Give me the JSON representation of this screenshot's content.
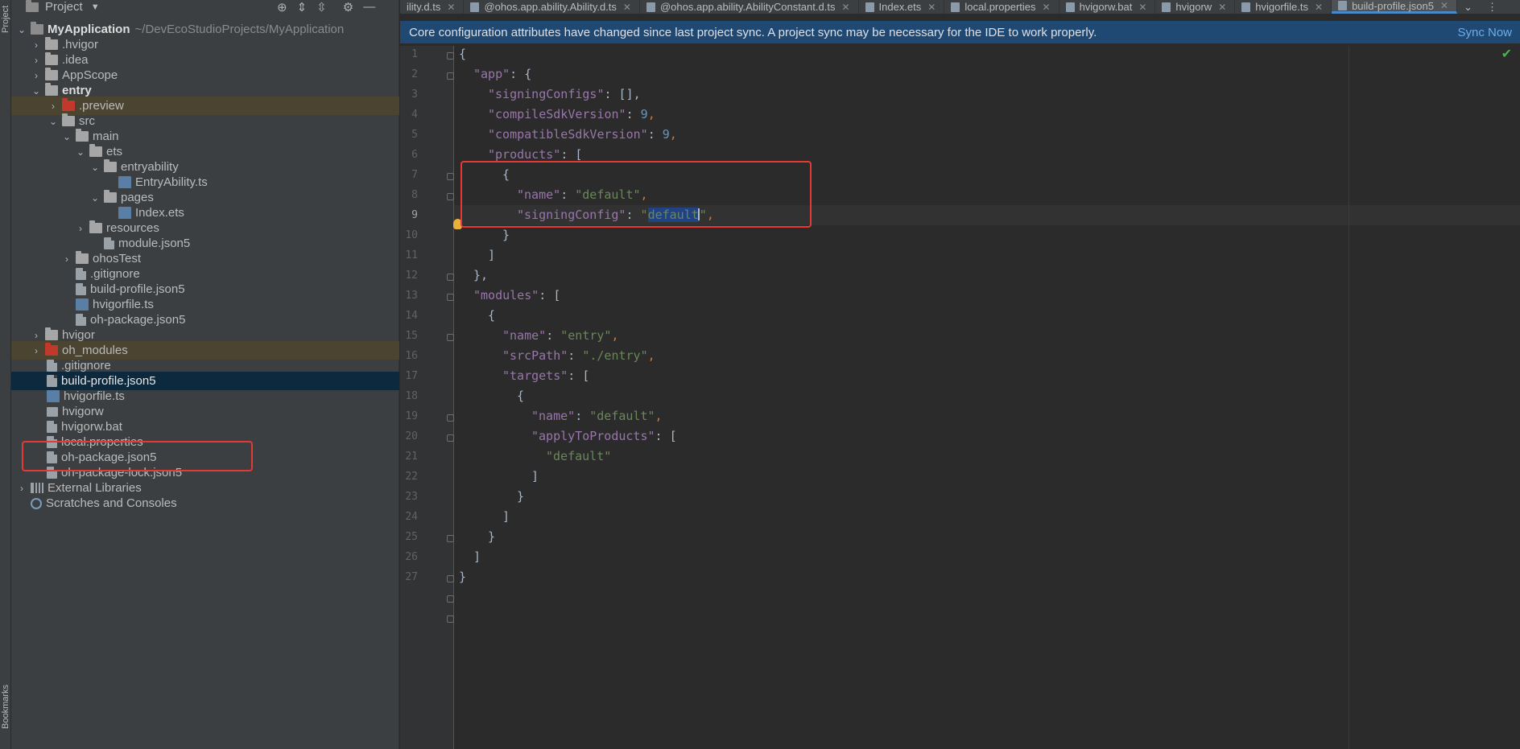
{
  "toolstrip": {
    "project_label": "Project",
    "bookmarks_label": "Bookmarks"
  },
  "project_panel": {
    "title": "Project",
    "tree": [
      {
        "label": "MyApplication",
        "path": "~/DevEcoStudioProjects/MyApplication"
      },
      {
        "label": ".hvigor"
      },
      {
        "label": ".idea"
      },
      {
        "label": "AppScope"
      },
      {
        "label": "entry"
      },
      {
        "label": ".preview"
      },
      {
        "label": "src"
      },
      {
        "label": "main"
      },
      {
        "label": "ets"
      },
      {
        "label": "entryability"
      },
      {
        "label": "EntryAbility.ts"
      },
      {
        "label": "pages"
      },
      {
        "label": "Index.ets"
      },
      {
        "label": "resources"
      },
      {
        "label": "module.json5"
      },
      {
        "label": "ohosTest"
      },
      {
        "label": ".gitignore"
      },
      {
        "label": "build-profile.json5"
      },
      {
        "label": "hvigorfile.ts"
      },
      {
        "label": "oh-package.json5"
      },
      {
        "label": "hvigor"
      },
      {
        "label": "oh_modules"
      },
      {
        "label": ".gitignore"
      },
      {
        "label": "build-profile.json5"
      },
      {
        "label": "hvigorfile.ts"
      },
      {
        "label": "hvigorw"
      },
      {
        "label": "hvigorw.bat"
      },
      {
        "label": "local.properties"
      },
      {
        "label": "oh-package.json5"
      },
      {
        "label": "oh-package-lock.json5"
      },
      {
        "label": "External Libraries"
      },
      {
        "label": "Scratches and Consoles"
      }
    ]
  },
  "tabs": [
    {
      "label": "ility.d.ts"
    },
    {
      "label": "@ohos.app.ability.Ability.d.ts"
    },
    {
      "label": "@ohos.app.ability.AbilityConstant.d.ts"
    },
    {
      "label": "Index.ets"
    },
    {
      "label": "local.properties"
    },
    {
      "label": "hvigorw.bat"
    },
    {
      "label": "hvigorw"
    },
    {
      "label": "hvigorfile.ts"
    },
    {
      "label": "build-profile.json5"
    }
  ],
  "banner": {
    "message": "Core configuration attributes have changed since last project sync. A project sync may be necessary for the IDE to work properly.",
    "action": "Sync Now"
  },
  "editor": {
    "current_line": 9,
    "line_numbers": [
      "1",
      "2",
      "3",
      "4",
      "5",
      "6",
      "7",
      "8",
      "9",
      "10",
      "11",
      "12",
      "13",
      "14",
      "15",
      "16",
      "17",
      "18",
      "19",
      "20",
      "21",
      "22",
      "23",
      "24",
      "25",
      "26",
      "27"
    ],
    "code": {
      "l1": "{",
      "l2_key": "\"app\"",
      "l2_rest": ": {",
      "l3_key": "\"signingConfigs\"",
      "l3_rest": ": [],",
      "l4_key": "\"compileSdkVersion\"",
      "l4_num": "9",
      "l5_key": "\"compatibleSdkVersion\"",
      "l5_num": "9",
      "l6_key": "\"products\"",
      "l6_rest": ": [",
      "l7": "{",
      "l8_key": "\"name\"",
      "l8_val": "\"default\"",
      "l9_key": "\"signingConfig\"",
      "l9_q": "\"",
      "l9_sel": "default",
      "l9_q2": "\"",
      "l10": "}",
      "l11": "]",
      "l12": "},",
      "l13_key": "\"modules\"",
      "l13_rest": ": [",
      "l14": "{",
      "l15_key": "\"name\"",
      "l15_val": "\"entry\"",
      "l16_key": "\"srcPath\"",
      "l16_val": "\"./entry\"",
      "l17_key": "\"targets\"",
      "l17_rest": ": [",
      "l18": "{",
      "l19_key": "\"name\"",
      "l19_val": "\"default\"",
      "l20_key": "\"applyToProducts\"",
      "l20_rest": ": [",
      "l21_val": "\"default\"",
      "l22": "]",
      "l23": "}",
      "l24": "]",
      "l25": "}",
      "l26": "]",
      "l27": "}"
    }
  },
  "colors": {
    "highlight_box": "#e53935",
    "banner_bg": "#1f4872",
    "selection": "#214283"
  }
}
